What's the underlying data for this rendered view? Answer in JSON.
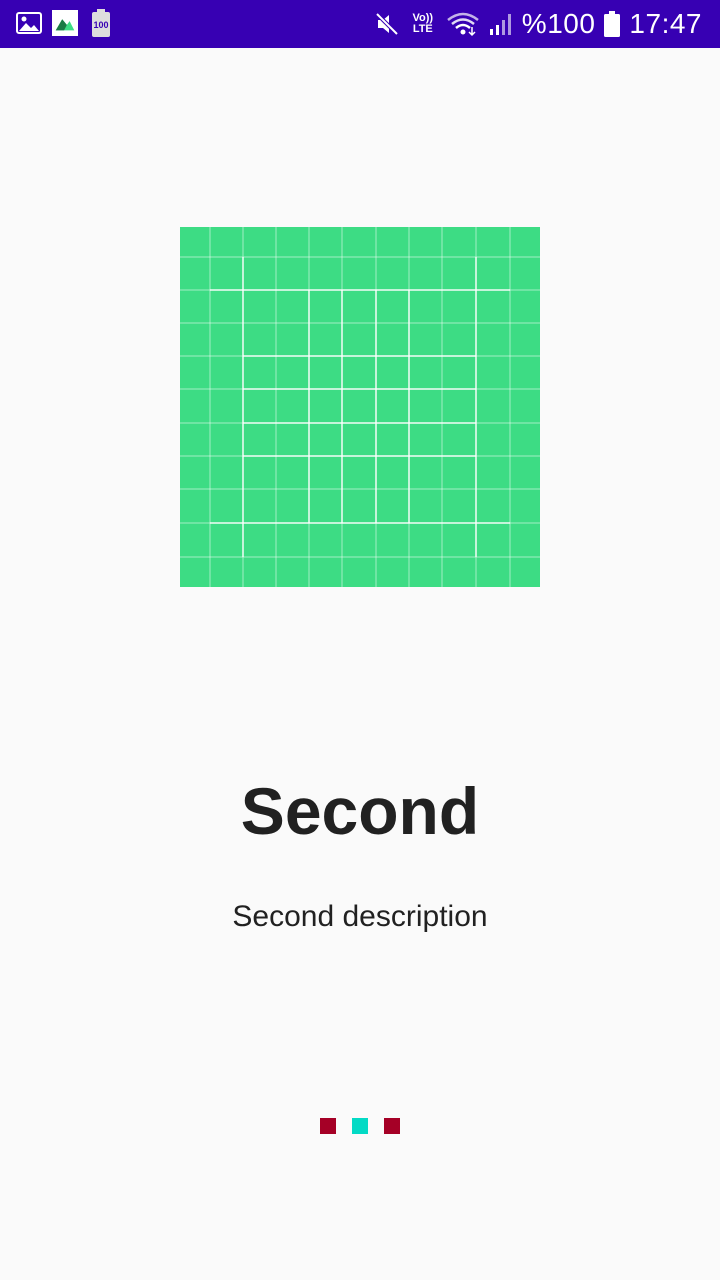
{
  "status_bar": {
    "battery_percent": "%100",
    "time": "17:47",
    "volte_label": "Vo)) LTE",
    "notification_badge": "100",
    "icons": [
      "image-icon",
      "app-notification-icon",
      "battery-notification-icon",
      "mute-icon",
      "volte-icon",
      "wifi-icon",
      "signal-icon",
      "battery-icon"
    ]
  },
  "onboarding": {
    "title": "Second",
    "description": "Second description",
    "current_page": 2,
    "total_pages": 3
  },
  "colors": {
    "status_bar": "#3700b3",
    "background": "#fafafa",
    "hero": "#3ddc84",
    "indicator_inactive": "#a50026",
    "indicator_active": "#03dac5",
    "text": "#212121"
  }
}
